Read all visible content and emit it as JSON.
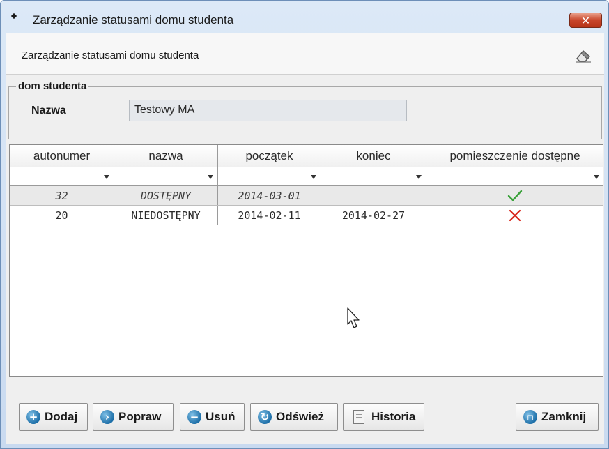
{
  "window": {
    "title": "Zarządzanie statusami domu studenta",
    "close_glyph": "✕"
  },
  "header": {
    "title": "Zarządzanie statusami domu studenta",
    "icon": "eraser-icon"
  },
  "dorm_section": {
    "legend": "dom studenta",
    "name_label": "Nazwa",
    "name_value": "Testowy MA"
  },
  "table": {
    "columns": [
      "autonumer",
      "nazwa",
      "początek",
      "koniec",
      "pomieszczenie dostępne"
    ],
    "rows": [
      {
        "autonumer": "32",
        "nazwa": "DOSTĘPNY",
        "poczatek": "2014-03-01",
        "koniec": "",
        "dostepne": "check-icon"
      },
      {
        "autonumer": "20",
        "nazwa": "NIEDOSTĘPNY",
        "poczatek": "2014-02-11",
        "koniec": "2014-02-27",
        "dostepne": "cross-icon"
      }
    ]
  },
  "buttons": {
    "add": "Dodaj",
    "edit": "Popraw",
    "delete": "Usuń",
    "refresh": "Odśwież",
    "history": "Historia",
    "close": "Zamknij"
  },
  "colors": {
    "accent_blue": "#1d6fa8",
    "check_green": "#3aa13a",
    "cross_red": "#d8261b",
    "close_red": "#c8452a"
  }
}
